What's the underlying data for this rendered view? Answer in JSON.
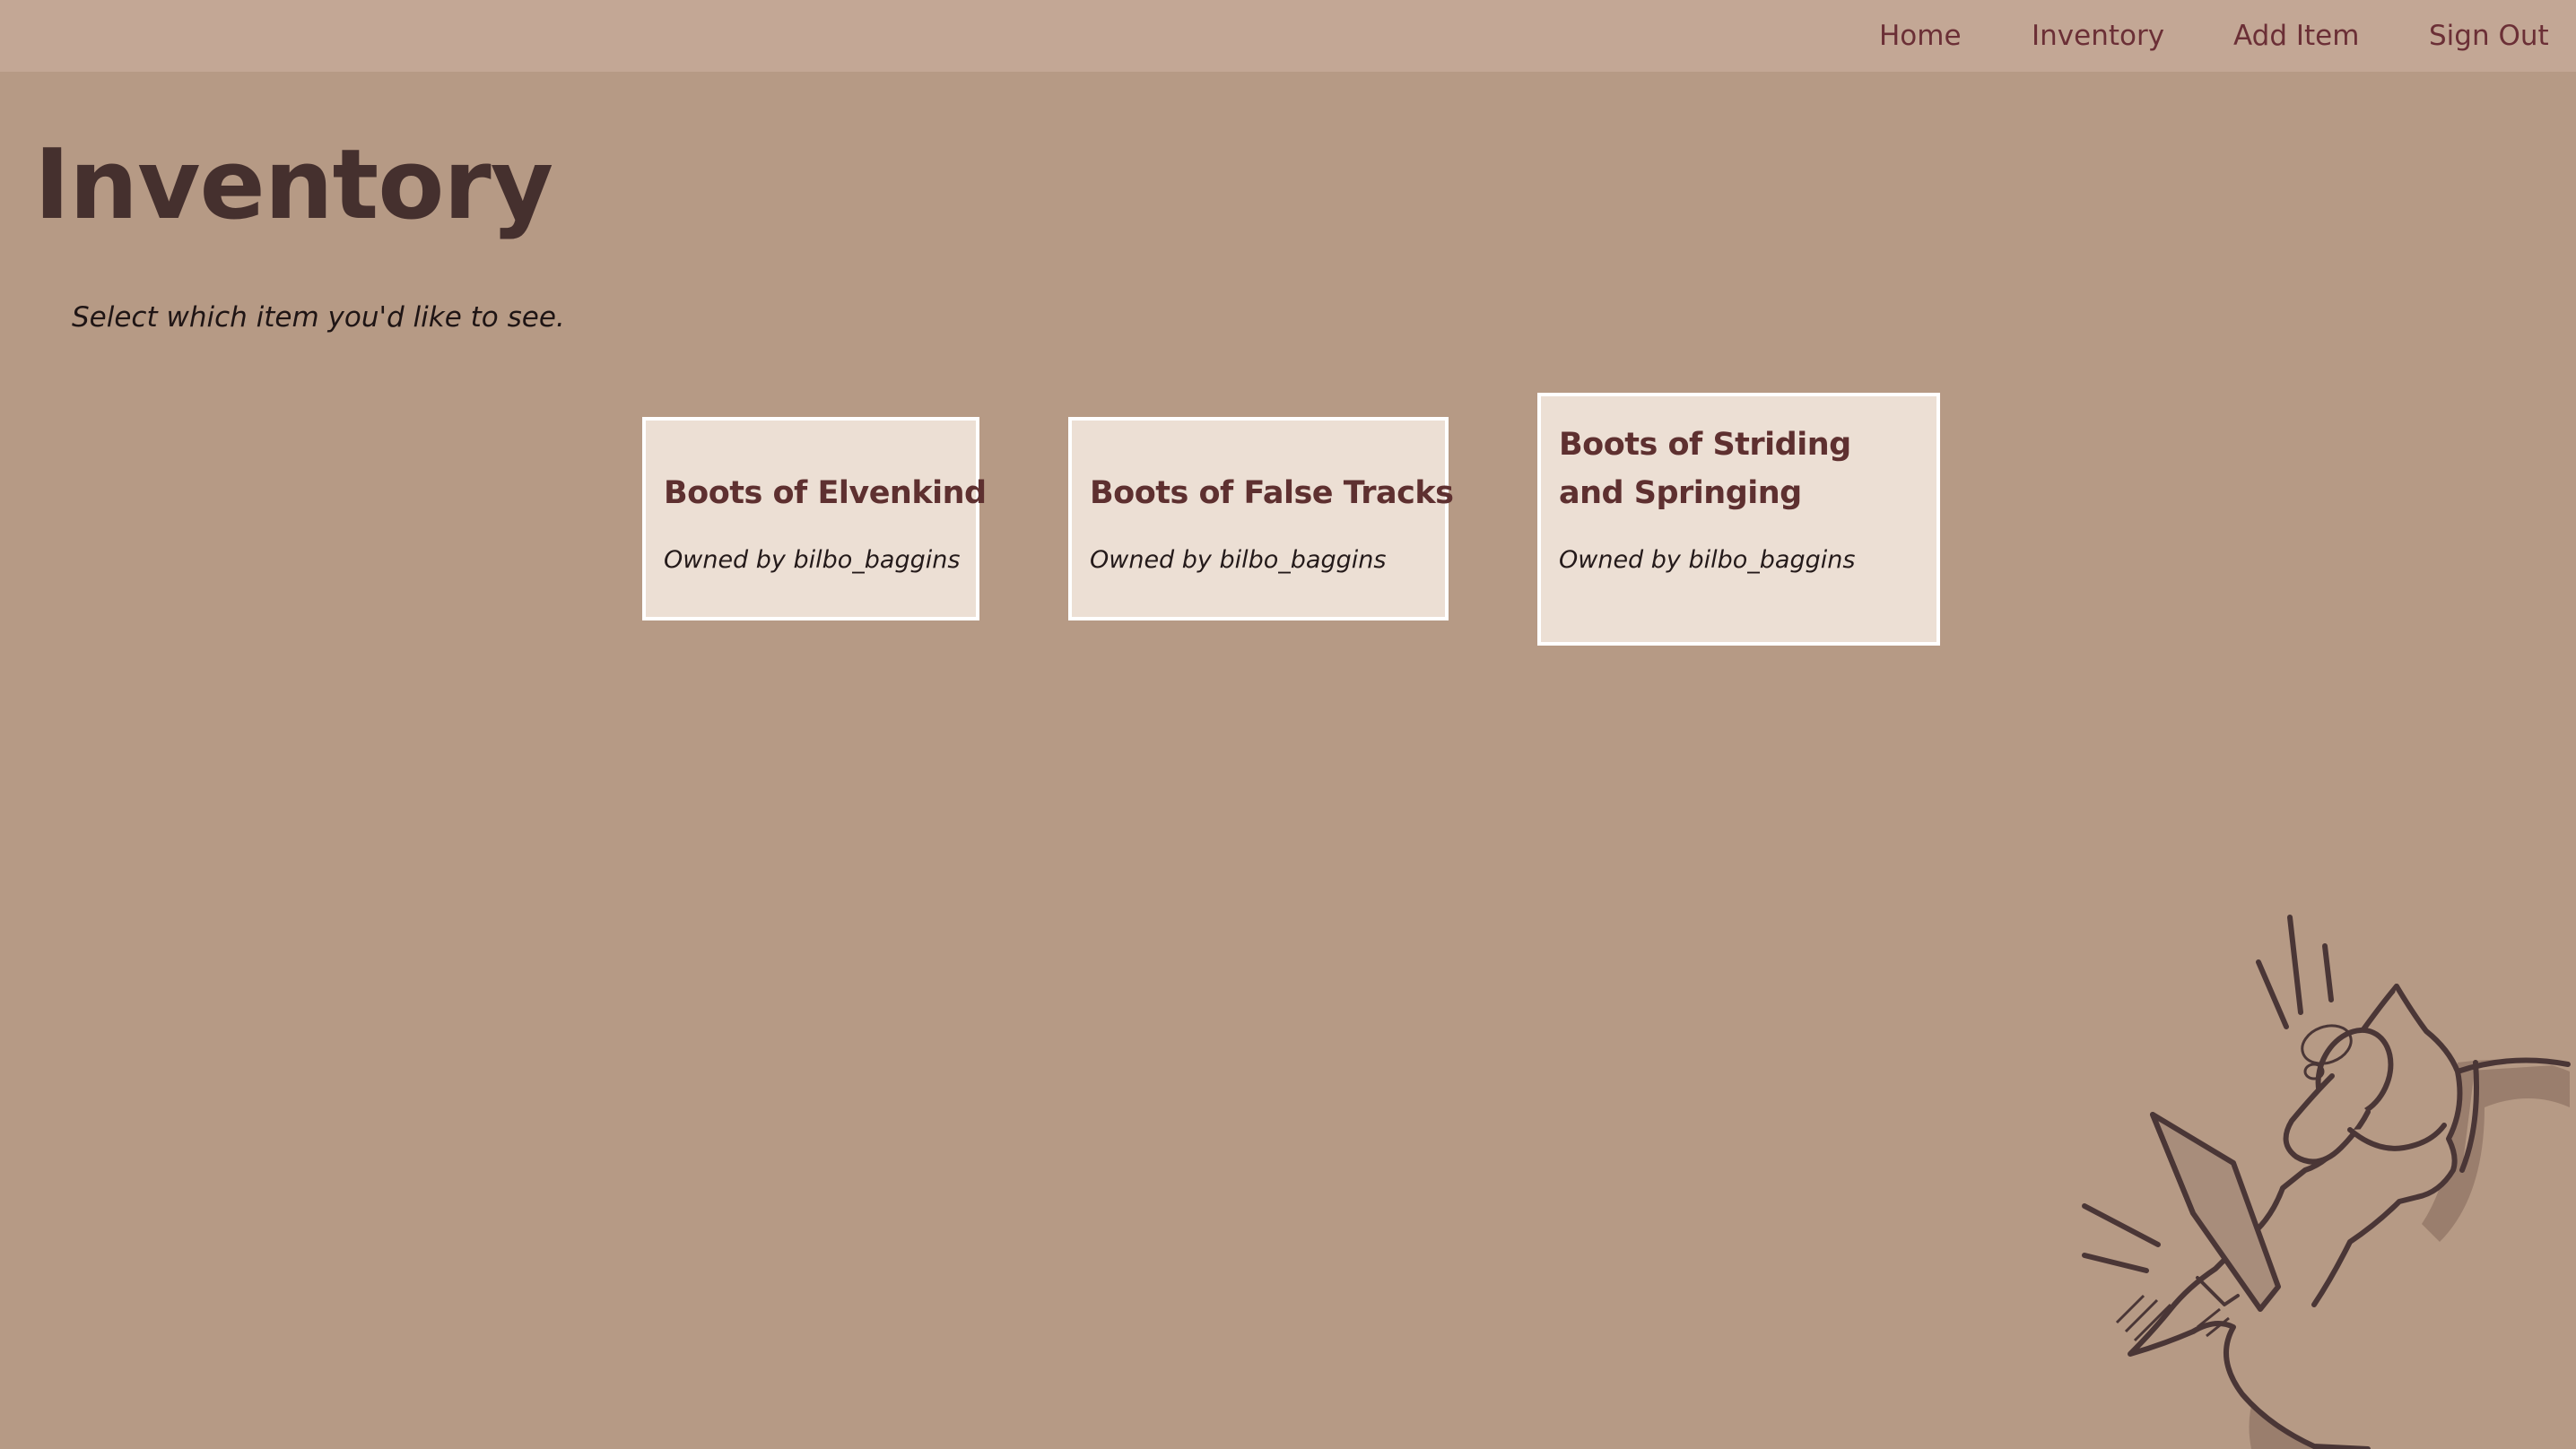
{
  "nav": {
    "home": "Home",
    "inventory": "Inventory",
    "add_item": "Add Item",
    "sign_out": "Sign Out"
  },
  "page": {
    "title": "Inventory",
    "subtitle": "Select which item you'd like to see."
  },
  "items": [
    {
      "name": "Boots of Elvenkind",
      "owner": "Owned by bilbo_baggins"
    },
    {
      "name": "Boots of False Tracks",
      "owner": "Owned by bilbo_baggins"
    },
    {
      "name": "Boots of Striding and Springing",
      "owner": "Owned by bilbo_baggins"
    }
  ],
  "decoration": {
    "icon": "hand-holding-quill-illustration"
  },
  "colors": {
    "background": "#b69a85",
    "navbar": "#c3a795",
    "nav_link": "#6b2f36",
    "title": "#45302e",
    "card_bg": "#ecdfd4",
    "card_title": "#5e3030"
  }
}
